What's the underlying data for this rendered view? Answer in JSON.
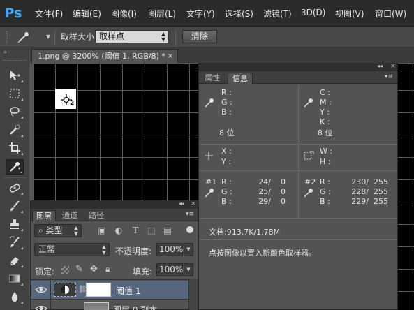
{
  "app": {
    "logo": "Ps"
  },
  "menu": [
    "文件(F)",
    "编辑(E)",
    "图像(I)",
    "图层(L)",
    "文字(Y)",
    "选择(S)",
    "滤镜(T)",
    "3D(D)",
    "视图(V)",
    "窗口(W)"
  ],
  "options_bar": {
    "sample_size_label": "取样大小:",
    "sample_size_value": "取样点",
    "clear_button": "清除"
  },
  "document": {
    "tab_title": "1.png @ 3200% (阈值 1, RGB/8) *",
    "close_glyph": "×",
    "sampler_number": "2"
  },
  "info_panel": {
    "tabs": [
      "属性",
      "信息"
    ],
    "active_tab": "信息",
    "rgb_labels": [
      "R :",
      "G :",
      "B :"
    ],
    "cmyk_labels": [
      "C :",
      "M :",
      "Y :",
      "K :"
    ],
    "bit_depth_left": "8 位",
    "bit_depth_right": "8 位",
    "xy_labels": [
      "X :",
      "Y :"
    ],
    "wh_labels": [
      "W :",
      "H :"
    ],
    "sampler1": {
      "id": "#1",
      "labels": [
        "R :",
        "G :",
        "B :"
      ],
      "values": [
        "24/    0",
        "25/    0",
        "29/    0"
      ]
    },
    "sampler2": {
      "id": "#2",
      "labels": [
        "R :",
        "G :",
        "B :"
      ],
      "values": [
        "230/  255",
        "228/  255",
        "229/  255"
      ]
    },
    "doc_size": "文档:913.7K/1.78M",
    "hint": "点按图像以置入新颜色取样器。"
  },
  "layers_panel": {
    "tabs": [
      "图层",
      "通道",
      "路径"
    ],
    "active_tab": "图层",
    "filter_label": "类型",
    "blend_mode": "正常",
    "opacity_label": "不透明度:",
    "opacity_value": "100%",
    "lock_label": "锁定:",
    "fill_label": "填充:",
    "fill_value": "100%",
    "layers": [
      {
        "name": "阈值 1",
        "selected": true
      },
      {
        "name": "图层 0 副本",
        "selected": false
      }
    ]
  },
  "colors": {
    "accent_logo": "#3fa9f5",
    "menubar": "#2b2b2b",
    "panel": "#535353",
    "selected_layer": "#58677d"
  }
}
